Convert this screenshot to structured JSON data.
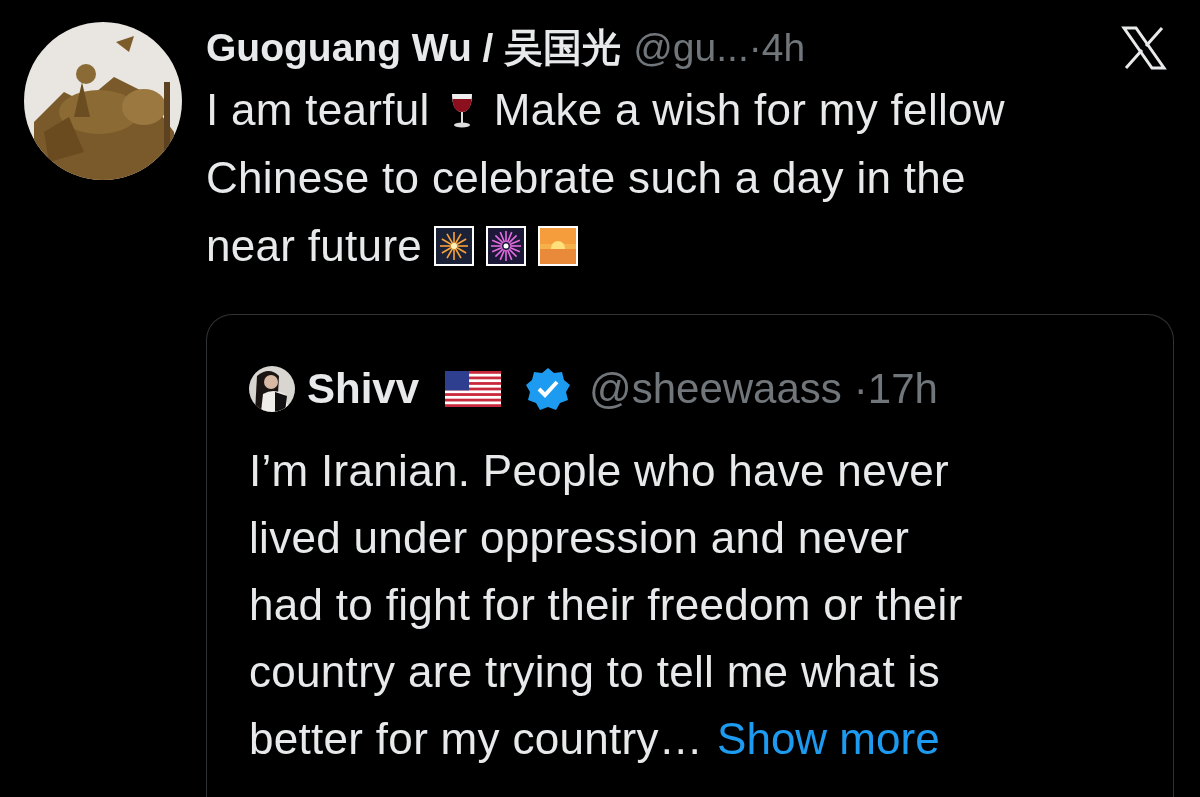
{
  "tweet": {
    "author": {
      "name": "Guoguang Wu / 吴国光",
      "handle": "@gu...",
      "time": "·4h"
    },
    "lines": [
      [
        {
          "kind": "text",
          "text": "I am tearful"
        },
        {
          "kind": "wine-glass"
        },
        {
          "kind": "text",
          "text": "Make a wish for my fellow"
        }
      ],
      [
        {
          "kind": "text",
          "text": "Chinese to celebrate such a day in the"
        }
      ],
      [
        {
          "kind": "text",
          "text": "near future"
        },
        {
          "kind": "sparkler"
        },
        {
          "kind": "fireworks"
        },
        {
          "kind": "sunrise"
        }
      ]
    ],
    "quote": {
      "author": {
        "name": "Shivv",
        "flag": true,
        "verified": true,
        "handle": "@sheewaass",
        "time": "·17h"
      },
      "lines": [
        "I’m Iranian. People who have never",
        "lived under oppression and never",
        "had to fight for their freedom or their",
        "country are trying to tell me what is",
        "better for my country…"
      ],
      "more_link": "Show more"
    }
  }
}
